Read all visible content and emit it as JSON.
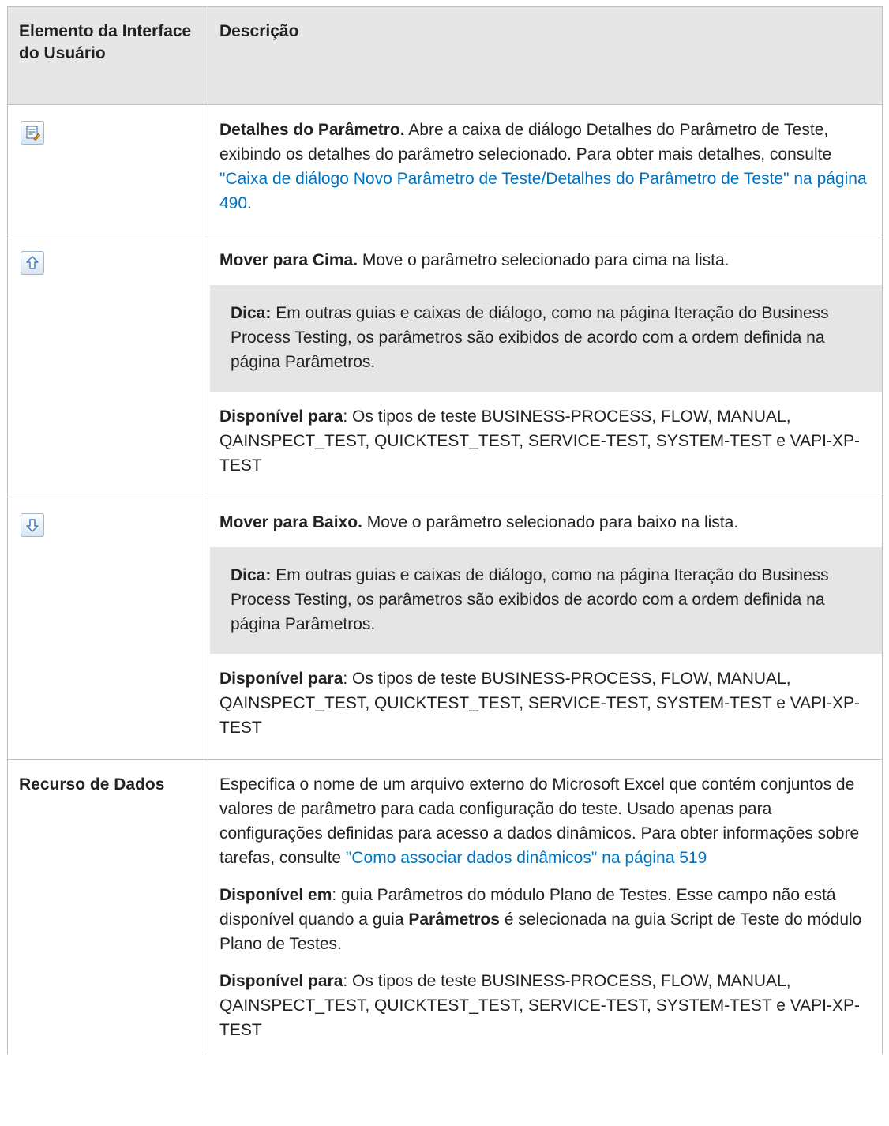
{
  "table": {
    "headers": [
      "Elemento da Interface do Usuário",
      "Descrição"
    ],
    "rows": {
      "details": {
        "icon": "parameter-details-icon",
        "title": "Detalhes do Parâmetro.",
        "text1": " Abre a caixa de diálogo Detalhes do Parâmetro de Teste, exibindo os detalhes do parâmetro selecionado. Para obter mais detalhes, consulte ",
        "link": "\"Caixa de diálogo Novo Parâmetro de Teste/Detalhes do Parâmetro de Teste\" na página 490",
        "text2": "."
      },
      "move_up": {
        "icon": "move-up-arrow-icon",
        "title": "Mover para Cima.",
        "text": " Move o parâmetro selecionado para cima na lista.",
        "tip_label": "Dica:",
        "tip_text": " Em outras guias e caixas de diálogo, como na página Iteração do Business Process Testing, os parâmetros são exibidos de acordo com a ordem definida na página Parâmetros.",
        "avail_label": "Disponível para",
        "avail_text": ": Os tipos de teste BUSINESS-PROCESS, FLOW, MANUAL, QAINSPECT_TEST, QUICKTEST_TEST,  SERVICE-TEST, SYSTEM-TEST e VAPI-XP-TEST"
      },
      "move_down": {
        "icon": "move-down-arrow-icon",
        "title": "Mover para Baixo.",
        "text": " Move o parâmetro selecionado para baixo na lista.",
        "tip_label": "Dica:",
        "tip_text": " Em outras guias e caixas de diálogo, como na página Iteração do Business Process Testing, os parâmetros são exibidos de acordo com a ordem definida na página Parâmetros.",
        "avail_label": "Disponível para",
        "avail_text": ": Os tipos de teste BUSINESS-PROCESS, FLOW, MANUAL, QAINSPECT_TEST, QUICKTEST_TEST,  SERVICE-TEST, SYSTEM-TEST e VAPI-XP-TEST"
      },
      "data_resource": {
        "label": "Recurso de Dados",
        "text1": "Especifica o nome de um arquivo externo do Microsoft Excel que contém conjuntos de valores de parâmetro para cada configuração do teste. Usado apenas para configurações definidas para acesso a dados dinâmicos. Para obter informações sobre tarefas, consulte ",
        "link": "\"Como associar dados dinâmicos\" na página 519",
        "avail_in_label": "Disponível em",
        "avail_in_text1": ": guia Parâmetros do módulo Plano de Testes. Esse campo não está disponível quando a guia ",
        "avail_in_bold": "Parâmetros",
        "avail_in_text2": " é selecionada na guia Script de Teste do módulo Plano de Testes.",
        "avail_label": "Disponível para",
        "avail_text": ": Os tipos de teste BUSINESS-PROCESS, FLOW, MANUAL, QAINSPECT_TEST, QUICKTEST_TEST,  SERVICE-TEST, SYSTEM-TEST e VAPI-XP-TEST"
      }
    }
  }
}
